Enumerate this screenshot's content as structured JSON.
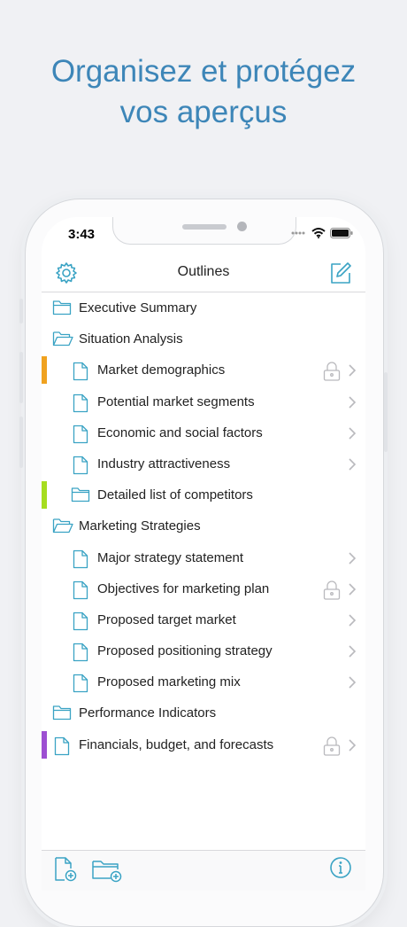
{
  "headline": {
    "line1": "Organisez et protégez",
    "line2": "vos aperçus"
  },
  "status_bar": {
    "time": "3:43"
  },
  "nav": {
    "title": "Outlines",
    "settings_icon": "gear-icon",
    "compose_icon": "compose-icon"
  },
  "colors": {
    "accent": "#3aa3c4",
    "headline": "#3d86b8",
    "orange": "#f0a21f",
    "green": "#a6dd1f",
    "purple": "#9d4fd2"
  },
  "outline": [
    {
      "label": "Executive Summary",
      "type": "folder",
      "indent": 0,
      "locked": false,
      "chevron": false,
      "mark": ""
    },
    {
      "label": "Situation Analysis",
      "type": "folder-open",
      "indent": 0,
      "locked": false,
      "chevron": false,
      "mark": ""
    },
    {
      "label": "Market demographics",
      "type": "doc",
      "indent": 1,
      "locked": true,
      "chevron": true,
      "mark": "orange"
    },
    {
      "label": "Potential market segments",
      "type": "doc",
      "indent": 1,
      "locked": false,
      "chevron": true,
      "mark": ""
    },
    {
      "label": "Economic and social factors",
      "type": "doc",
      "indent": 1,
      "locked": false,
      "chevron": true,
      "mark": ""
    },
    {
      "label": "Industry attractiveness",
      "type": "doc",
      "indent": 1,
      "locked": false,
      "chevron": true,
      "mark": ""
    },
    {
      "label": "Detailed list of competitors",
      "type": "folder",
      "indent": 1,
      "locked": false,
      "chevron": false,
      "mark": "green"
    },
    {
      "label": "Marketing Strategies",
      "type": "folder-open",
      "indent": 0,
      "locked": false,
      "chevron": false,
      "mark": ""
    },
    {
      "label": "Major strategy statement",
      "type": "doc",
      "indent": 1,
      "locked": false,
      "chevron": true,
      "mark": ""
    },
    {
      "label": "Objectives for marketing plan",
      "type": "doc",
      "indent": 1,
      "locked": true,
      "chevron": true,
      "mark": ""
    },
    {
      "label": "Proposed target market",
      "type": "doc",
      "indent": 1,
      "locked": false,
      "chevron": true,
      "mark": ""
    },
    {
      "label": "Proposed positioning strategy",
      "type": "doc",
      "indent": 1,
      "locked": false,
      "chevron": true,
      "mark": ""
    },
    {
      "label": "Proposed marketing mix",
      "type": "doc",
      "indent": 1,
      "locked": false,
      "chevron": true,
      "mark": ""
    },
    {
      "label": "Performance Indicators",
      "type": "folder",
      "indent": 0,
      "locked": false,
      "chevron": false,
      "mark": ""
    },
    {
      "label": "Financials, budget, and forecasts",
      "type": "doc",
      "indent": 0,
      "locked": true,
      "chevron": true,
      "mark": "purple"
    }
  ],
  "toolbar": {
    "new_document_icon": "new-document-icon",
    "new_folder_icon": "new-folder-icon",
    "info_icon": "info-icon"
  }
}
